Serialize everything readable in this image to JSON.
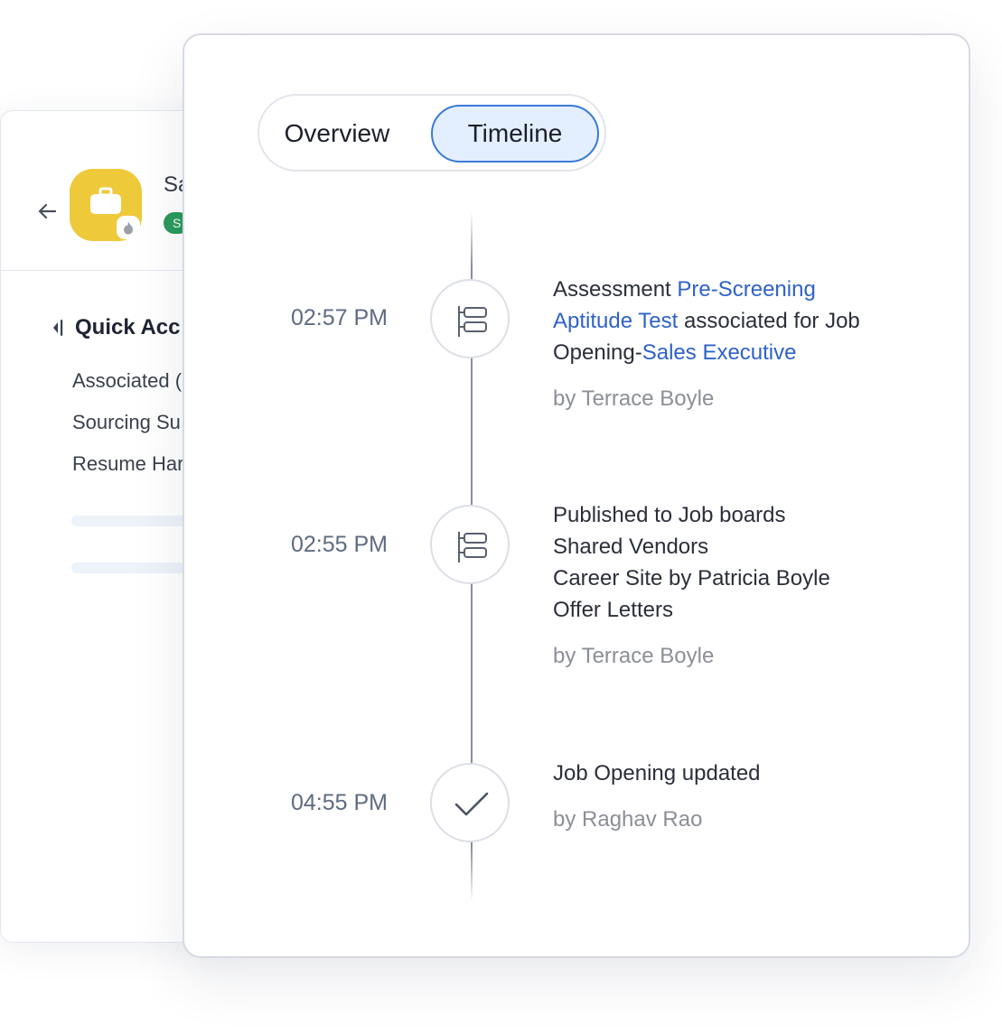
{
  "back_panel": {
    "job_title": "Sa",
    "status_badge": "S",
    "quick_access_title": "Quick Acc",
    "quick_items": [
      "Associated (",
      "Sourcing Su",
      "Resume Har"
    ]
  },
  "tabs": [
    {
      "label": "Overview",
      "active": false
    },
    {
      "label": "Timeline",
      "active": true
    }
  ],
  "timeline": [
    {
      "time": "02:57 PM",
      "icon": "list-icon",
      "line1_prefix": "Assessment ",
      "line1_link": "Pre-Screening",
      "line2_link": "Aptitude Test",
      "line2_suffix": " associated for Job",
      "line3_prefix": "Opening-",
      "line3_link": "Sales Executive",
      "by": "by Terrace Boyle"
    },
    {
      "time": "02:55 PM",
      "icon": "list-icon",
      "lines": [
        "Published to Job boards",
        "Shared Vendors",
        "Career Site by Patricia Boyle",
        "Offer Letters"
      ],
      "by": "by Terrace Boyle"
    },
    {
      "time": "04:55 PM",
      "icon": "check-icon",
      "lines": [
        "Job Opening updated"
      ],
      "by": "by Raghav Rao"
    }
  ],
  "colors": {
    "accent": "#2f62c8",
    "active_tab_bg": "#e3efff",
    "active_tab_border": "#3a79d6",
    "avatar_bg": "#eec93a",
    "badge_bg": "#2a9a5c"
  }
}
